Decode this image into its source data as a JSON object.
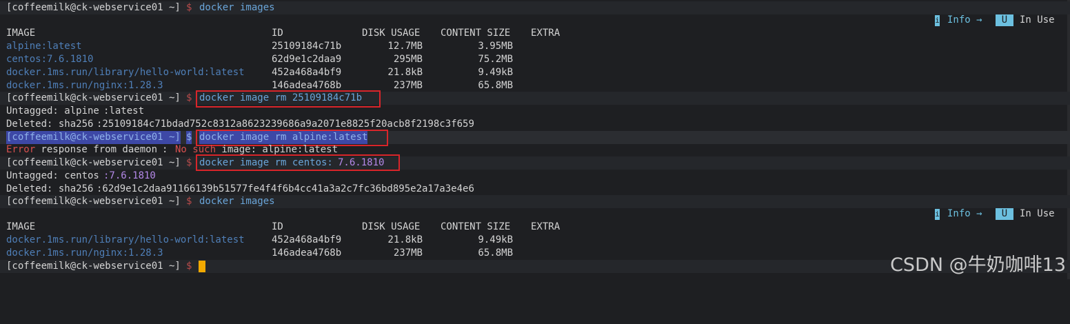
{
  "prompt": "[coffeemilk@ck-webservice01 ~]",
  "dollar": "$",
  "cmd_images": "docker images",
  "cmd_rm_id": "docker image rm 25109184c71b",
  "cmd_rm_alpine": "docker image rm alpine:latest",
  "cmd_rm_centos_a": "docker image rm centos:",
  "cmd_rm_centos_b": "7.6.1810",
  "status_info": {
    "badge": "i",
    "label": "Info →",
    "use_badge": "U",
    "use_label": "In Use"
  },
  "table_headers": {
    "image": "IMAGE",
    "id": "ID",
    "disk": "DISK USAGE",
    "content": "CONTENT SIZE",
    "extra": "EXTRA"
  },
  "table1": [
    {
      "image": "alpine:latest",
      "id": "25109184c71b",
      "disk": "12.7MB",
      "content": "3.95MB"
    },
    {
      "image": "centos:7.6.1810",
      "id": "62d9e1c2daa9",
      "disk": "295MB",
      "content": "75.2MB"
    },
    {
      "image": "docker.1ms.run/library/hello-world:latest",
      "id": "452a468a4bf9",
      "disk": "21.8kB",
      "content": "9.49kB"
    },
    {
      "image": "docker.1ms.run/nginx:1.28.3",
      "id": "146adea4768b",
      "disk": "237MB",
      "content": "65.8MB"
    }
  ],
  "out_untag_alpine_a": "Untagged: alpine",
  "out_untag_alpine_b": ":latest",
  "out_del_alpine_a": "Deleted: sha256",
  "out_del_alpine_b": ":25109184c71bdad752c8312a8623239686a9a2071e8825f20acb8f2198c3f659",
  "out_err_a": "Error",
  "out_err_b": " response from daemon",
  "out_err_c": ": ",
  "out_err_d": "No such",
  "out_err_e": " image: alpine:latest",
  "out_untag_centos_a": "Untagged: centos",
  "out_untag_centos_b": ":7.6.1810",
  "out_del_centos_a": "Deleted: sha256",
  "out_del_centos_b": ":62d9e1c2daa91166139b51577fe4f4f6b4cc41a3a2c7fc36bd895e2a17a3e4e6",
  "table2": [
    {
      "image": "docker.1ms.run/library/hello-world:latest",
      "id": "452a468a4bf9",
      "disk": "21.8kB",
      "content": "9.49kB"
    },
    {
      "image": "docker.1ms.run/nginx:1.28.3",
      "id": "146adea4768b",
      "disk": "237MB",
      "content": "65.8MB"
    }
  ],
  "watermark": "CSDN @牛奶咖啡13",
  "colors": {
    "background": "#1e1f22",
    "command": "#6aa5d9",
    "error": "#d8504f",
    "highlight_box": "#d9252a",
    "cursor": "#f2a900",
    "info": "#6cc0e0"
  }
}
